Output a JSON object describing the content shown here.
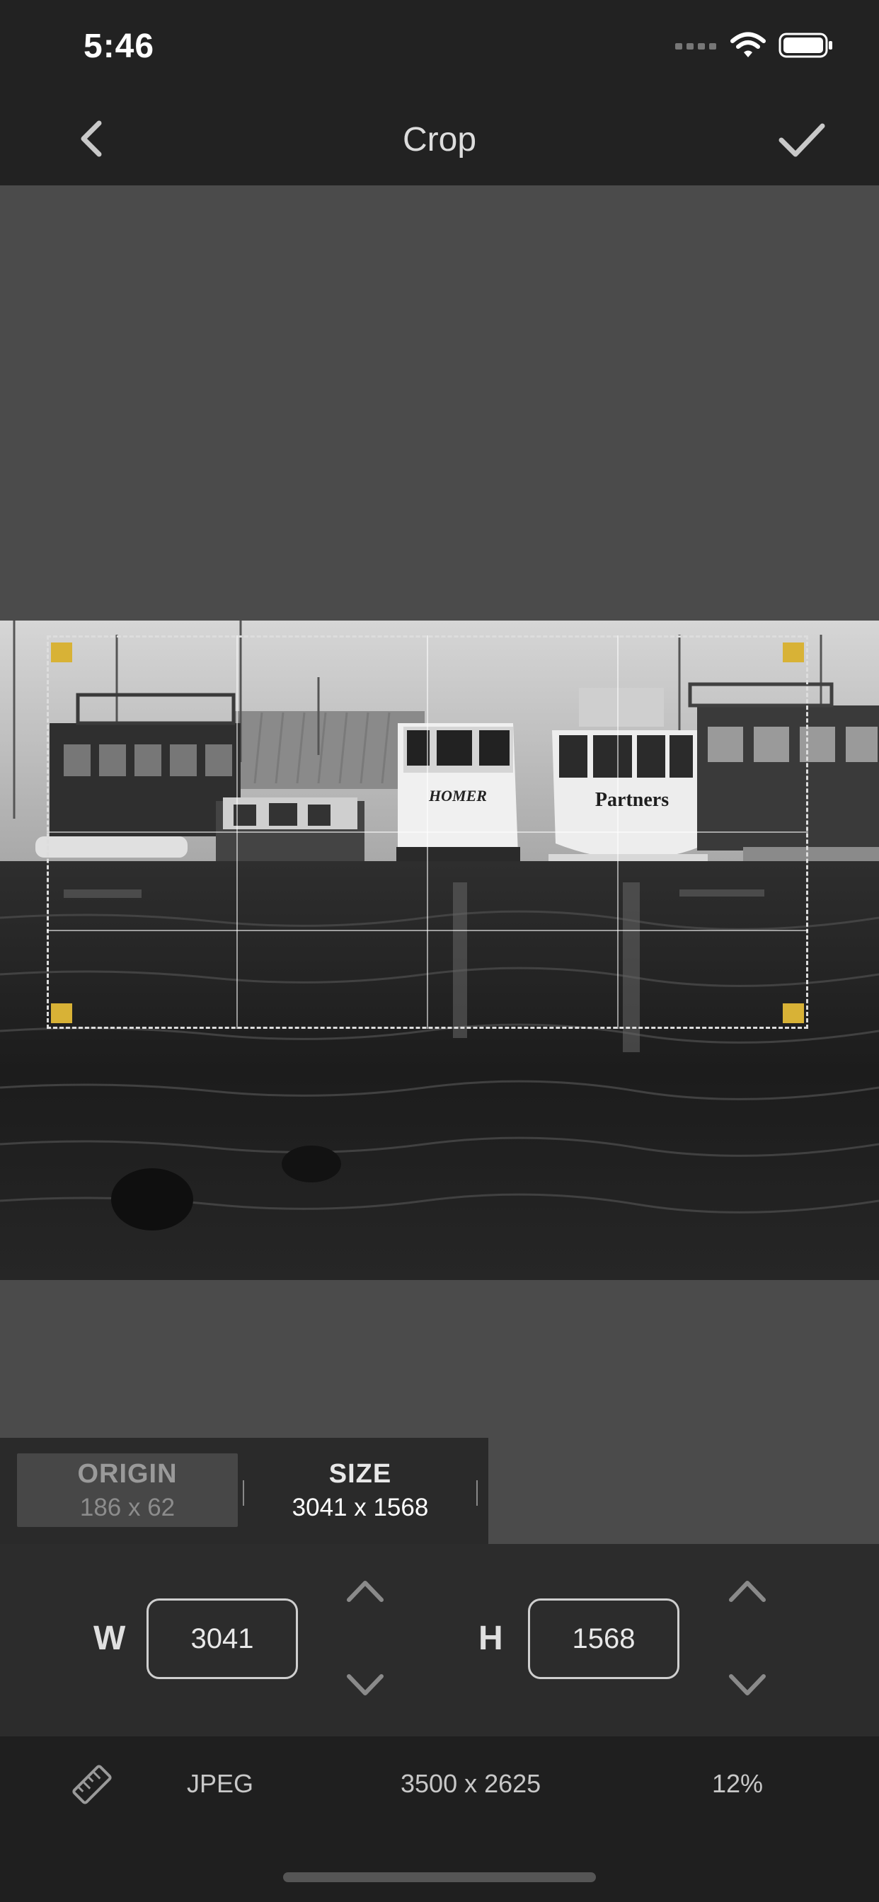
{
  "status_bar": {
    "time": "5:46"
  },
  "nav": {
    "title": "Crop"
  },
  "tabs": {
    "origin": {
      "label": "ORIGIN",
      "value": "186 x 62"
    },
    "size": {
      "label": "SIZE",
      "value": "3041 x 1568"
    }
  },
  "editor": {
    "width_label": "W",
    "width_value": "3041",
    "height_label": "H",
    "height_value": "1568"
  },
  "info_bar": {
    "format": "JPEG",
    "dimensions": "3500 x 2625",
    "zoom": "12%"
  },
  "photo_text": {
    "boat1": "HOMER",
    "boat2": "Partners"
  },
  "colors": {
    "accent": "#d8b236",
    "background": "#4b4b4b",
    "bar": "#222222"
  },
  "icons": [
    "signal-icon",
    "wifi-icon",
    "battery-icon",
    "back-chevron-icon",
    "checkmark-icon",
    "chevron-up-icon",
    "chevron-down-icon",
    "ruler-icon"
  ]
}
